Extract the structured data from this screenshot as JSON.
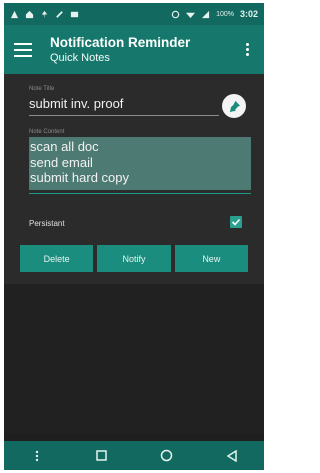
{
  "status_bar": {
    "time": "3:02",
    "battery": "100%",
    "left_icons": [
      "notification-icon",
      "home-icon",
      "pin-icon",
      "note-icon",
      "phone-icon"
    ],
    "right_icons": [
      "alarm-icon",
      "wifi-icon",
      "signal-icon"
    ]
  },
  "app_bar": {
    "title": "Notification Reminder",
    "subtitle": "Quick Notes"
  },
  "form": {
    "note_title_label": "Note Title",
    "note_title_value": "submit inv. proof",
    "note_content_label": "Note Content",
    "note_content_lines": [
      "scan all doc",
      "send email",
      "submit hard copy"
    ],
    "persistent_label": "Persistant",
    "persistent_checked": true
  },
  "actions": {
    "delete_label": "Delete",
    "notify_label": "Notify",
    "new_label": "New"
  },
  "colors": {
    "status_bar": "#11695f",
    "app_bar": "#16786c",
    "accent": "#1a8d7e",
    "background": "#2b2b2b"
  }
}
